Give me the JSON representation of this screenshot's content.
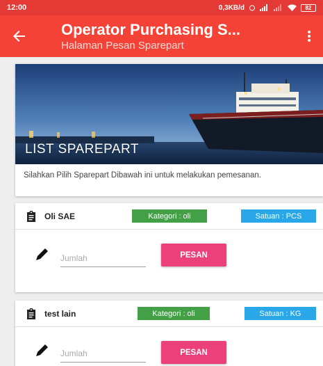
{
  "status_bar": {
    "time": "12:00",
    "network_speed": "0,3KB/d",
    "battery": "82"
  },
  "toolbar": {
    "title": "Operator Purchasing S...",
    "subtitle": "Halaman Pesan Sparepart",
    "background_color": "#f44336"
  },
  "hero": {
    "caption": "LIST SPAREPART",
    "description": "Silahkan Pilih Sparepart Dibawah ini untuk melakukan pemesanan."
  },
  "items": [
    {
      "name": "Oli SAE",
      "category": "Kategori : oli",
      "unit": "Satuan : PCS",
      "qty_placeholder": "Jumlah",
      "order_label": "PESAN"
    },
    {
      "name": "test lain",
      "category": "Kategori : oli",
      "unit": "Satuan : KG",
      "qty_placeholder": "Jumlah",
      "order_label": "PESAN"
    }
  ],
  "colors": {
    "accent": "#ec407a",
    "category_badge": "#43a047",
    "unit_badge": "#29a7e8"
  },
  "icons": {
    "back": "arrow-back-icon",
    "more": "more-vert-icon",
    "item": "clipboard-icon",
    "qty": "pencil-icon"
  }
}
